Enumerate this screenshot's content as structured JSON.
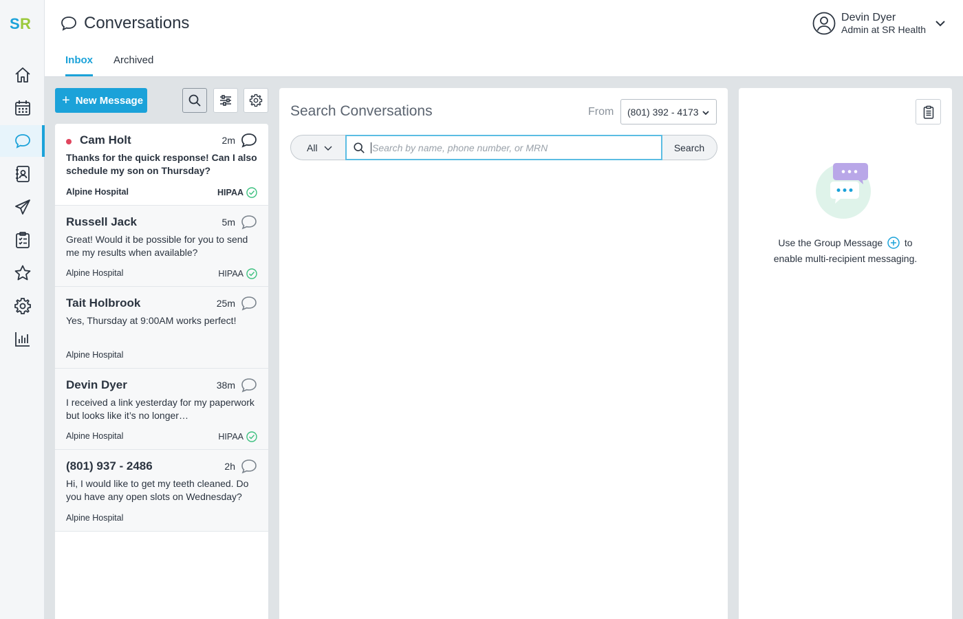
{
  "app": {
    "logo_text": "SR",
    "colors": {
      "accent": "#1ba2d9",
      "unread": "#e0465e",
      "success": "#3cc07f"
    }
  },
  "nav": {
    "items": [
      {
        "name": "home",
        "icon": "home-icon"
      },
      {
        "name": "calendar",
        "icon": "calendar-icon"
      },
      {
        "name": "conversations",
        "icon": "chat-bubble-icon",
        "active": true
      },
      {
        "name": "contacts",
        "icon": "contact-book-icon"
      },
      {
        "name": "campaigns",
        "icon": "paper-plane-icon"
      },
      {
        "name": "tasks",
        "icon": "clipboard-checklist-icon"
      },
      {
        "name": "reviews",
        "icon": "star-icon"
      },
      {
        "name": "settings",
        "icon": "gear-icon"
      },
      {
        "name": "reports",
        "icon": "bar-chart-icon"
      }
    ]
  },
  "header": {
    "title": "Conversations",
    "tabs": [
      {
        "label": "Inbox",
        "active": true
      },
      {
        "label": "Archived",
        "active": false
      }
    ],
    "user": {
      "name": "Devin Dyer",
      "role": "Admin at SR Health"
    }
  },
  "toolbar": {
    "new_message_label": "New Message"
  },
  "conversations": [
    {
      "name": "Cam Holt",
      "time": "2m",
      "unread": true,
      "message": "Thanks for the quick response! Can I also schedule my son on Thursday?",
      "org": "Alpine Hospital",
      "hipaa": "HIPAA"
    },
    {
      "name": "Russell Jack",
      "time": "5m",
      "unread": false,
      "message": "Great! Would it be possible for you to send me my results when available?",
      "org": "Alpine Hospital",
      "hipaa": "HIPAA"
    },
    {
      "name": "Tait Holbrook",
      "time": "25m",
      "unread": false,
      "message": "Yes, Thursday at 9:00AM works perfect!",
      "org": "Alpine Hospital",
      "hipaa": ""
    },
    {
      "name": "Devin Dyer",
      "time": "38m",
      "unread": false,
      "message": "I received a link yesterday for my paperwork but looks like it’s no longer…",
      "org": "Alpine Hospital",
      "hipaa": "HIPAA"
    },
    {
      "name": "(801) 937 - 2486",
      "time": "2h",
      "unread": false,
      "message": "Hi, I would like to get my teeth cleaned. Do you have any open slots on Wednesday?",
      "org": "Alpine Hospital",
      "hipaa": ""
    }
  ],
  "search_panel": {
    "title": "Search Conversations",
    "from_label": "From",
    "from_value": "(801) 392 - 4173",
    "filter_value": "All",
    "placeholder": "Search by name, phone number, or MRN",
    "search_button": "Search"
  },
  "side_panel": {
    "hint_before": "Use the Group Message",
    "hint_after": "to",
    "hint_line2": "enable multi-recipient messaging."
  }
}
